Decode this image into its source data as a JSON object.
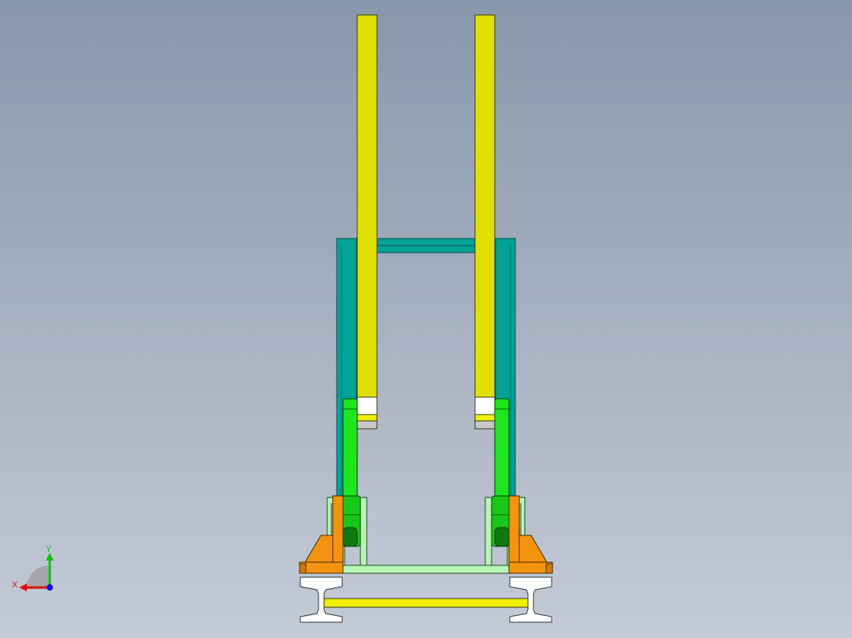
{
  "viewport": {
    "background_top": "#8897ab",
    "background_bottom": "#c4cbd7"
  },
  "model": {
    "parts": [
      {
        "name": "yellow-upright-left",
        "color": "#e0e000"
      },
      {
        "name": "yellow-upright-right",
        "color": "#e0e000"
      },
      {
        "name": "teal-frame",
        "color": "#00a396"
      },
      {
        "name": "green-link-left",
        "color": "#1ee61e"
      },
      {
        "name": "green-link-right",
        "color": "#1ee61e"
      },
      {
        "name": "orange-bracket-left",
        "color": "#f29410"
      },
      {
        "name": "orange-bracket-right",
        "color": "#f29410"
      },
      {
        "name": "light-green-crossbar",
        "color": "#b7f5b4"
      },
      {
        "name": "yellow-bottom-bar",
        "color": "#f0f000"
      },
      {
        "name": "rail-left",
        "color": "#ffffff"
      },
      {
        "name": "rail-right",
        "color": "#ffffff"
      }
    ]
  },
  "triad": {
    "x_label": "X",
    "y_label": "Y",
    "x_color": "#e01010",
    "y_color": "#10c010",
    "z_color": "#1010e0"
  }
}
